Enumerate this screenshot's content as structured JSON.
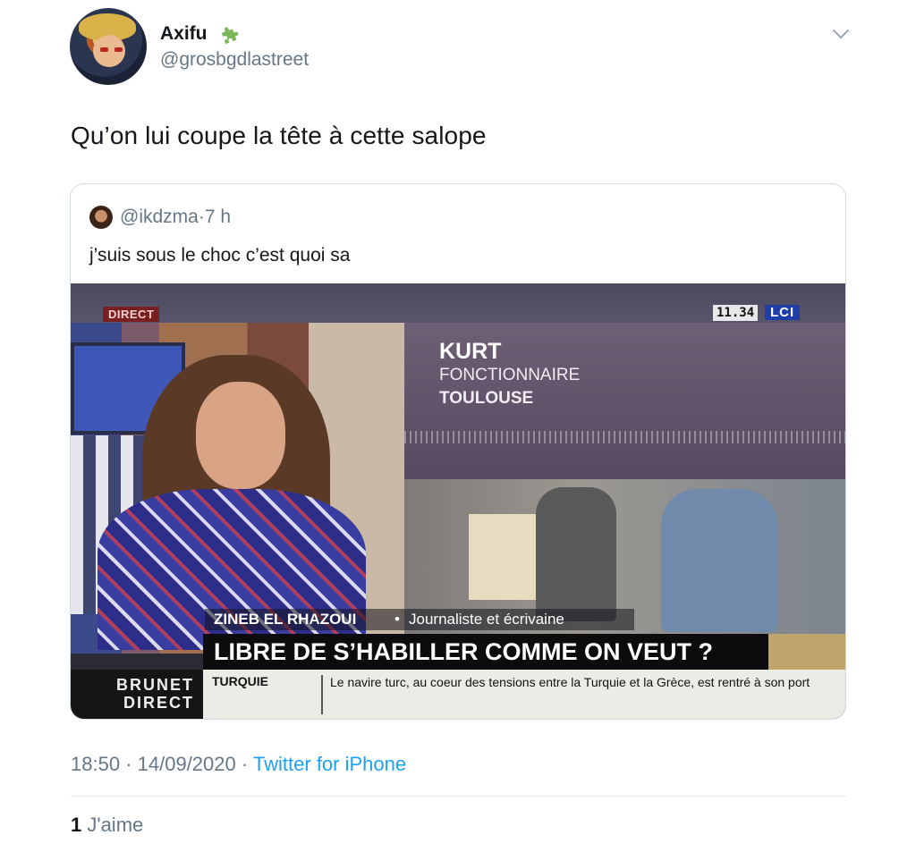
{
  "author": {
    "display_name": "Axifu",
    "badge_icon": "puzzle-piece-icon",
    "handle": "@grosbgdlastreet"
  },
  "tweet": {
    "text": "Qu’on lui coupe la tête à cette salope"
  },
  "quoted_tweet": {
    "handle": "@ikdzma",
    "separator": "·",
    "time": "7 h",
    "text": "j’suis sous le choc c’est quoi sa",
    "video": {
      "live_tag": "DIRECT",
      "clock": "11.34",
      "channel": "LCI",
      "interviewee_name": "KURT",
      "interviewee_job": "FONCTIONNAIRE",
      "interviewee_city": "TOULOUSE",
      "guest_name": "ZINEB EL RHAZOUI",
      "guest_separator": "•",
      "guest_role": "Journaliste et écrivaine",
      "headline": "LIBRE DE S’HABILLER COMME ON VEUT ?",
      "show_name_line1": "BRUNET",
      "show_name_line2": "DIRECT",
      "ticker_topic": "TURQUIE",
      "ticker_text": "Le navire turc, au coeur des tensions entre la Turquie et la Grèce, est rentré à son port"
    }
  },
  "meta": {
    "time": "18:50",
    "separator": "·",
    "date": "14/09/2020",
    "source": "Twitter for iPhone"
  },
  "stats": {
    "likes_count": "1",
    "likes_label": "J'aime"
  },
  "colors": {
    "link": "#1da1f2",
    "secondary_text": "#657786",
    "primary_text": "#14171a"
  }
}
